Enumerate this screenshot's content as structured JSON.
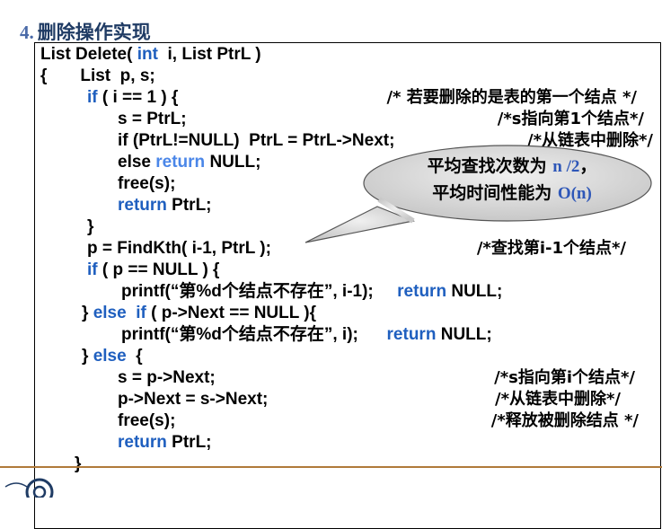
{
  "heading": {
    "number": "4.",
    "title": "删除操作实现"
  },
  "code": {
    "l1_a": "List Delete( ",
    "l1_kw": "int",
    "l1_b": "  i, List PtrL )",
    "l2": "{       List  p, s;",
    "l3_kw": "if",
    "l3_b": " ( i == 1 ) {",
    "l4": "s = PtrL;",
    "l5": "if (PtrL!=NULL)  PtrL = PtrL->Next;",
    "l6_a": "else ",
    "l6_kw": "return",
    "l6_b": " NULL;",
    "l7": "free(s);",
    "l8_kw": "return",
    "l8_b": " PtrL;",
    "l9": "}",
    "l10": "p = FindKth( i-1, PtrL );",
    "l11_kw": "if",
    "l11_b": " ( p == NULL ) {",
    "l12_a": "printf(“第%d个结点不存在”, i-1);     ",
    "l12_kw": "return",
    "l12_b": " NULL;",
    "l13_a": "} ",
    "l13_kw1": "else",
    "l13_mid": "  ",
    "l13_kw2": "if",
    "l13_b": " ( p->Next == NULL ){",
    "l14_a": "printf(“第%d个结点不存在”, i);      ",
    "l14_kw": "return",
    "l14_b": " NULL;",
    "l15_a": "} ",
    "l15_kw": "else",
    "l15_b": "  {",
    "l16": "s = p->Next;",
    "l17": "p->Next = s->Next;",
    "l18": "free(s);",
    "l19_kw": "return",
    "l19_b": " PtrL;",
    "l20": "}"
  },
  "comments": {
    "c1": "/* 若要删除的是表的第一个结点 */",
    "c2": "/*s指向第1个结点*/",
    "c3": "/*从链表中删除*/",
    "c4": "/*查找第i-1个结点*/",
    "c5": "/*s指向第i个结点*/",
    "c6": "/*从链表中删除*/",
    "c7": "/*释放被删除结点 */"
  },
  "callout": {
    "line1_a": "平均查找次数为 ",
    "line1_hl": "n /2",
    "line1_b": "，",
    "line2_a": "平均时间性能为 ",
    "line2_hl": "O(n)"
  },
  "colors": {
    "keyword": "#1f5fbf",
    "rule": "#b07a3a",
    "callout_fill": "#d9d9d9"
  }
}
